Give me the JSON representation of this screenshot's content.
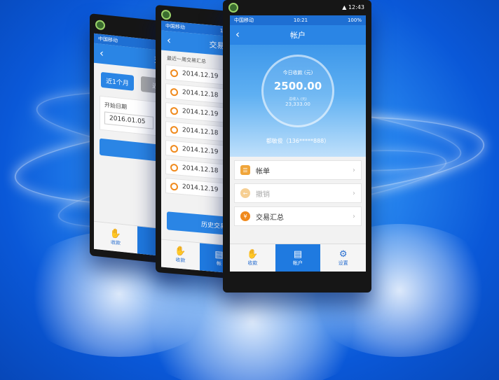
{
  "colors": {
    "accent": "#2a85e5",
    "icon_orange": "#f08a1d",
    "background": "#0a58d8"
  },
  "phone_left": {
    "status_carrier": "中国移动",
    "title": "交易",
    "back_icon": "chevron-left-icon",
    "range_buttons": [
      "近1个月",
      "近3"
    ],
    "start_label": "开始日期",
    "start_value": "2016.01.05",
    "confirm_label": "确",
    "tabs": [
      "收款",
      "帐"
    ]
  },
  "phone_middle": {
    "status_carrier": "中国移动",
    "status_time": "10:21",
    "title": "交易汇",
    "back_icon": "chevron-left-icon",
    "section_label": "最近一周交易汇总",
    "dates": [
      "2014.12.19",
      "2014.12.18",
      "2014.12.19",
      "2014.12.18",
      "2014.12.19",
      "2014.12.18",
      "2014.12.19"
    ],
    "history_button": "历史交易",
    "tabs": [
      "收款",
      "帐"
    ]
  },
  "phone_right": {
    "status_carrier": "中国移动",
    "status_time": "10:21",
    "status_battery": "100%",
    "system_time": "12:43",
    "title": "帐户",
    "back_icon": "chevron-left-icon",
    "today_label": "今日收款 (元)",
    "today_amount": "2500.00",
    "total_label": "总收入 (元)",
    "total_amount": "23,333.00",
    "user": "都敏俊（136*****888）",
    "menu": [
      {
        "label": "帐单",
        "icon": "bill-icon"
      },
      {
        "label": "撤销",
        "icon": "revoke-icon"
      },
      {
        "label": "交易汇总",
        "icon": "summary-icon"
      }
    ],
    "tabs": [
      "收款",
      "帐户",
      "设置"
    ]
  }
}
